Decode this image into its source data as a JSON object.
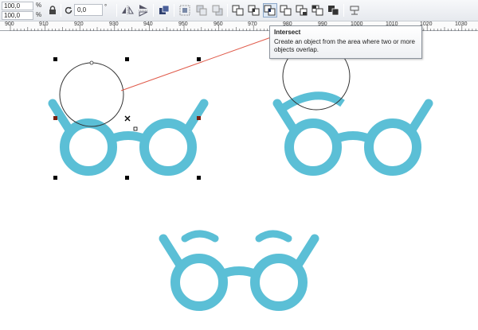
{
  "property_bar": {
    "scale_x": "100,0",
    "scale_y": "100,0",
    "scale_unit": "%",
    "angle": "0,0",
    "angle_unit": "°",
    "icons": {
      "lock": "lock-icon",
      "rotate": "rotate-icon",
      "mirror_horizontal": "mirror-horizontal-icon",
      "mirror_vertical": "mirror-vertical-icon",
      "group": "group-icon",
      "align": "align-distribute-icon",
      "to_front": "to-front-icon",
      "to_back": "to-back-icon",
      "weld": "weld-icon",
      "trim": "trim-icon",
      "intersect": "intersect-icon",
      "simplify": "simplify-icon",
      "front_minus_back": "front-minus-back-icon",
      "back_minus_front": "back-minus-front-icon",
      "create_boundary": "create-boundary-icon",
      "convert": "convert-icon"
    },
    "active_tool": "Intersect"
  },
  "ruler": {
    "labels": [
      "900",
      "910",
      "920",
      "930",
      "940",
      "950",
      "960",
      "970",
      "980",
      "990",
      "1000",
      "1010",
      "1020",
      "1030"
    ]
  },
  "tooltip": {
    "title": "Intersect",
    "body": "Create an object from the area where two or more objects overlap."
  },
  "colors": {
    "glasses": "#5bbfd6",
    "outline": "#333333",
    "handle": "#000000",
    "connector": "#e05a4a"
  }
}
